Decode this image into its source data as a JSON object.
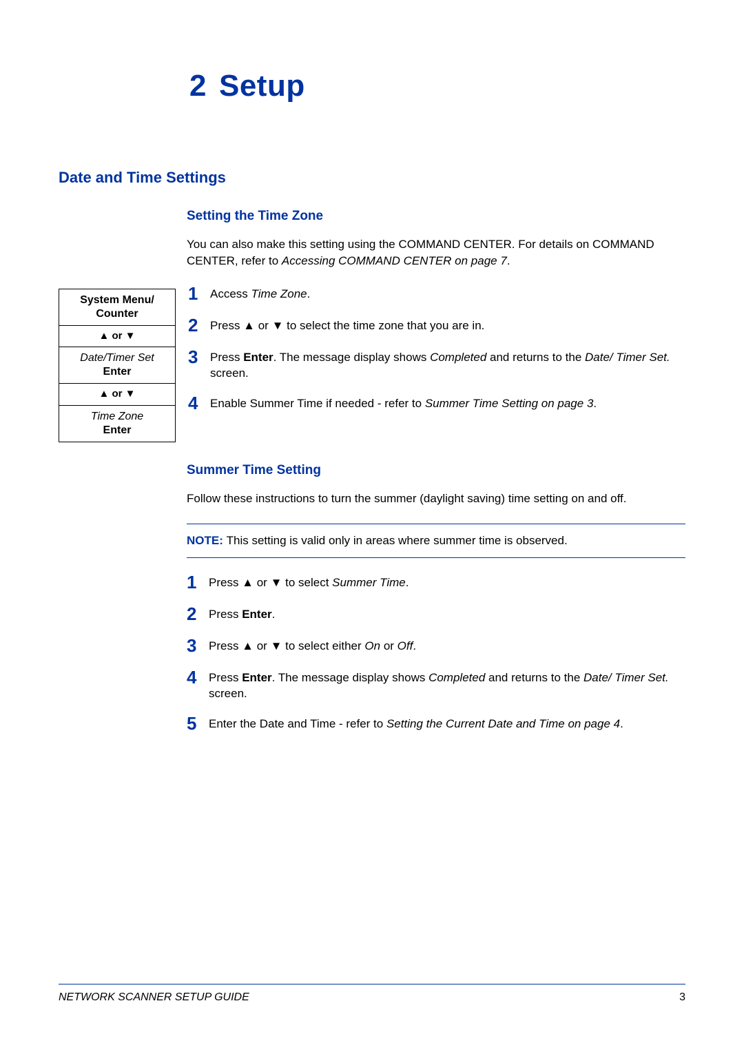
{
  "chapter": {
    "number": "2",
    "title": "Setup"
  },
  "h2": "Date and Time Settings",
  "section1": {
    "heading": "Setting the Time Zone",
    "intro_a": "You can also make this setting using the COMMAND CENTER. For details on COMMAND CENTER,  refer to ",
    "intro_ital": "Accessing COMMAND CENTER on page 7",
    "intro_b": ".",
    "menu": {
      "r1a": "System Menu/",
      "r1b": "Counter",
      "r2": "▲ or ▼",
      "r3a": "Date/Timer Set",
      "r3b": "Enter",
      "r4": "▲ or ▼",
      "r5a": "Time Zone",
      "r5b": "Enter"
    },
    "steps": [
      {
        "n": "1",
        "a": "Access ",
        "i1": "Time Zone",
        "b": "."
      },
      {
        "n": "2",
        "a": "Press ▲ or ▼ to select the time zone that you are in."
      },
      {
        "n": "3",
        "a": "Press ",
        "bold1": "Enter",
        "b": ". The message display shows ",
        "i1": "Completed",
        "c": " and returns to the ",
        "i2": "Date/ Timer Set.",
        "d": " screen."
      },
      {
        "n": "4",
        "a": "Enable Summer Time if needed - refer to ",
        "i1": "Summer Time Setting on page 3",
        "b": "."
      }
    ]
  },
  "section2": {
    "heading": "Summer Time Setting",
    "intro": "Follow these instructions to turn the summer (daylight saving) time setting on and off.",
    "note_label": "NOTE: ",
    "note_text": "This setting is valid only in areas where summer time is observed.",
    "steps": [
      {
        "n": "1",
        "a": "Press ▲ or ▼ to select ",
        "i1": "Summer Time",
        "b": "."
      },
      {
        "n": "2",
        "a": "Press ",
        "bold1": "Enter",
        "b": "."
      },
      {
        "n": "3",
        "a": "Press ▲ or ▼ to select either ",
        "i1": "On",
        "b": " or ",
        "i2": "Off",
        "c": "."
      },
      {
        "n": "4",
        "a": "Press ",
        "bold1": "Enter",
        "b": ". The message display shows ",
        "i1": "Completed",
        "c": " and returns to the ",
        "i2": "Date/ Timer Set.",
        "d": " screen."
      },
      {
        "n": "5",
        "a": "Enter the Date and Time - refer to ",
        "i1": "Setting the Current Date and Time on page 4",
        "b": "."
      }
    ]
  },
  "footer": {
    "guide": "NETWORK SCANNER SETUP GUIDE",
    "page": "3"
  }
}
